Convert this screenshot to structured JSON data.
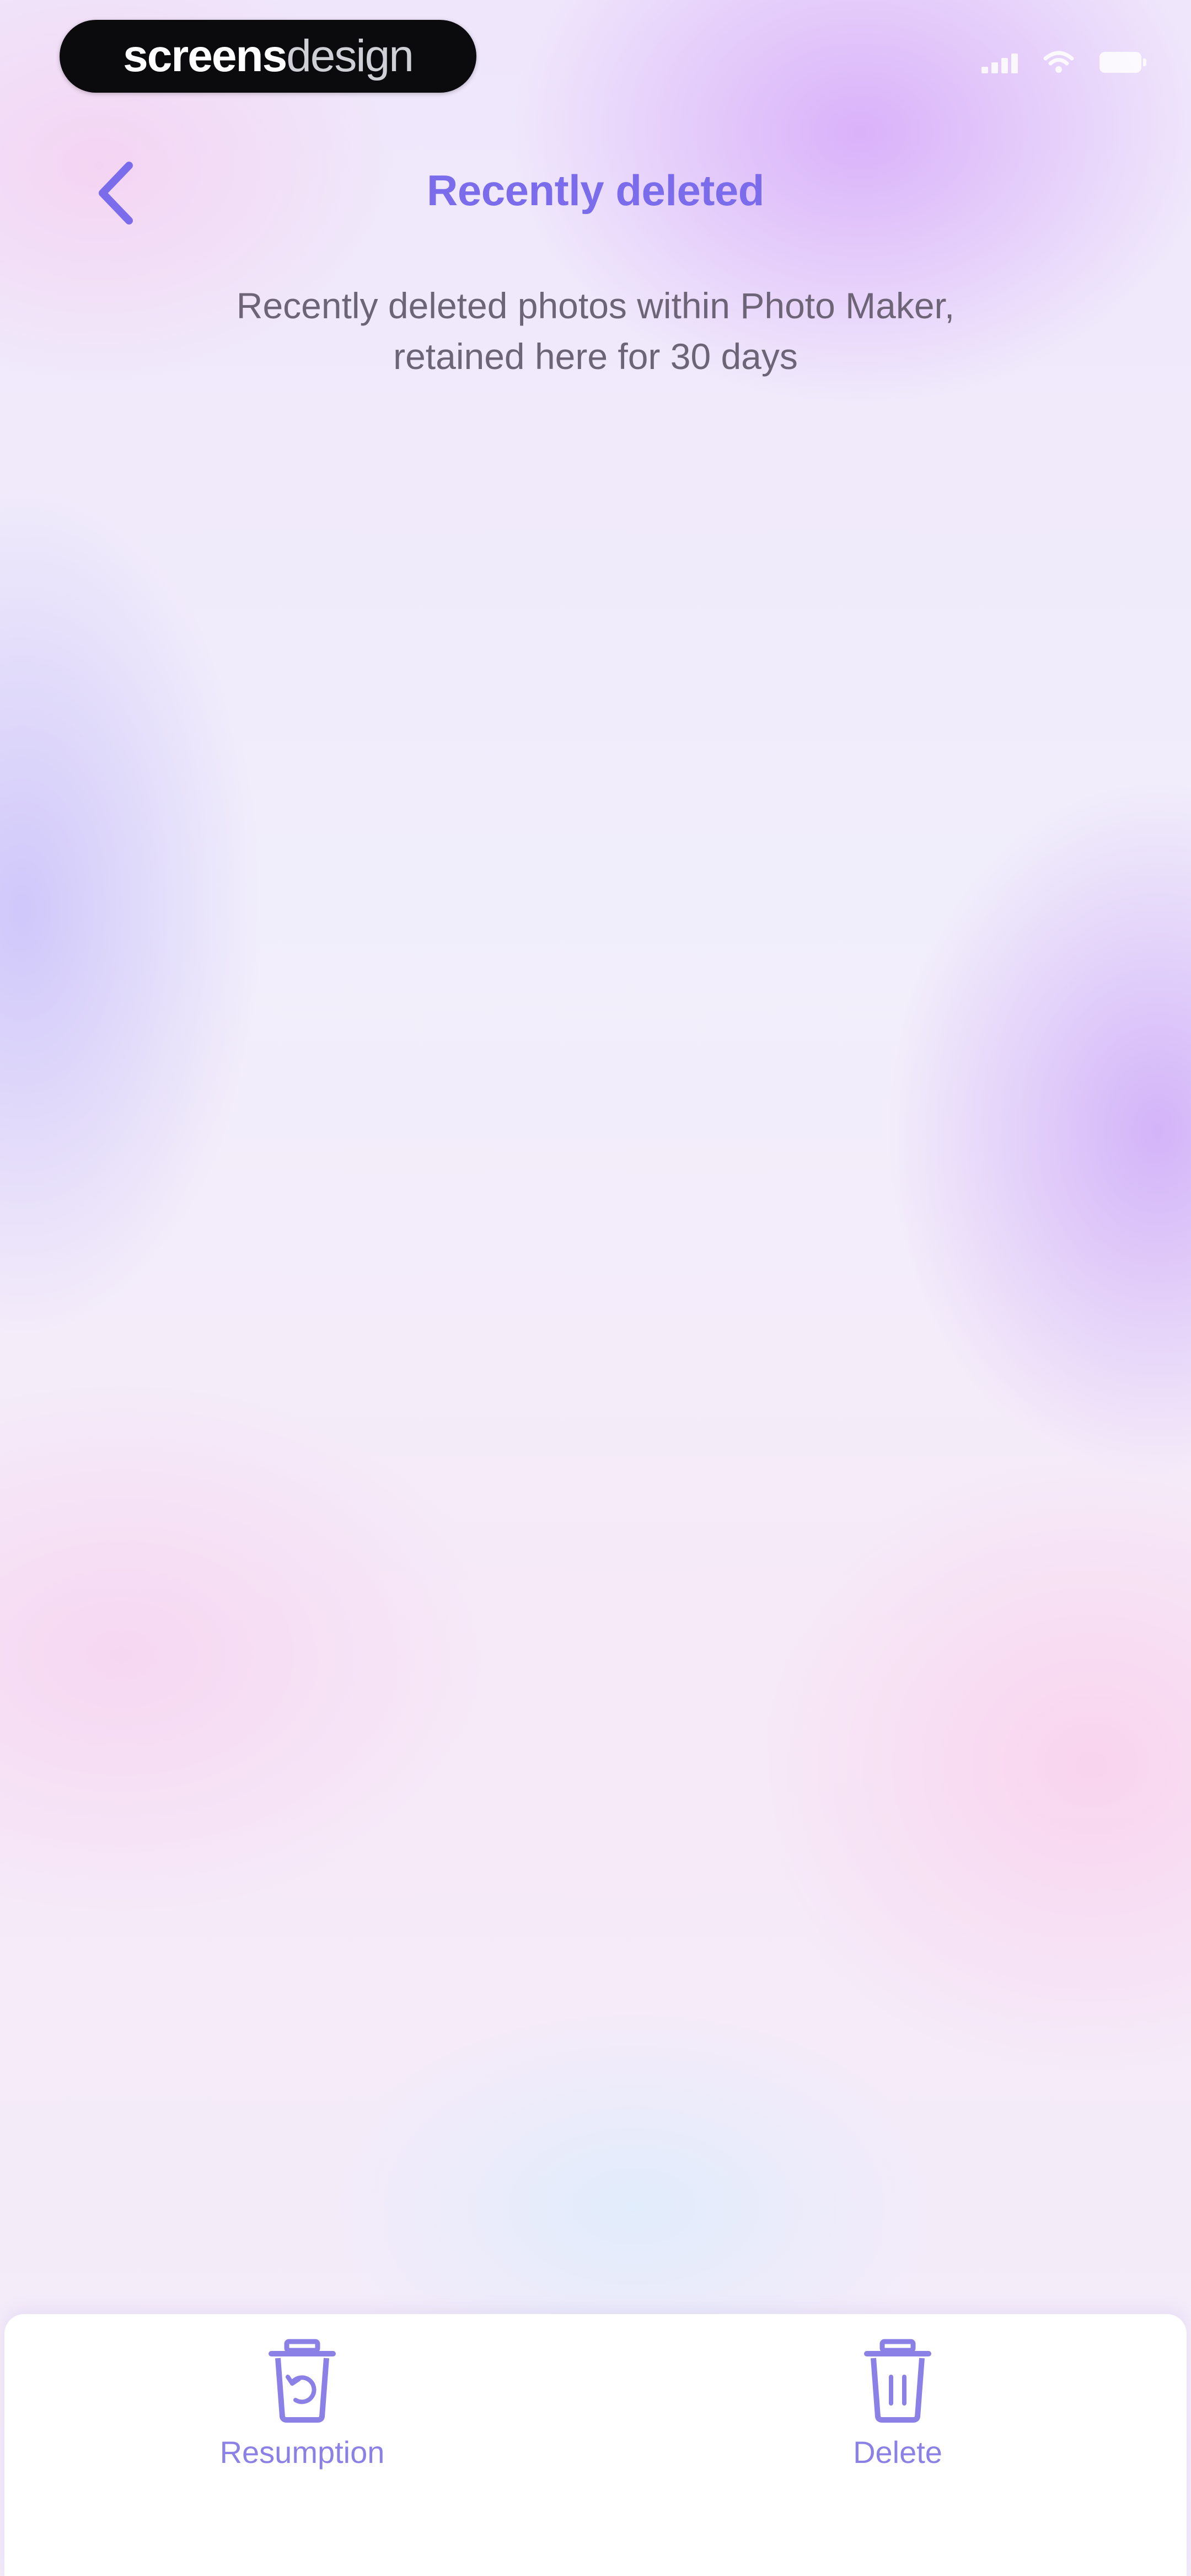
{
  "watermark": {
    "bold": "screens",
    "light": "design"
  },
  "nav": {
    "title": "Recently deleted"
  },
  "subtitle": {
    "line1": "Recently deleted photos within Photo Maker,",
    "line2": "retained here for 30 days"
  },
  "actions": [
    {
      "label": "Resumption",
      "icon": "restore-trash-icon"
    },
    {
      "label": "Delete",
      "icon": "trash-icon"
    }
  ],
  "colors": {
    "accent": "#7b6cec",
    "icon": "#8b80e6",
    "subtitle": "#6d6577"
  }
}
